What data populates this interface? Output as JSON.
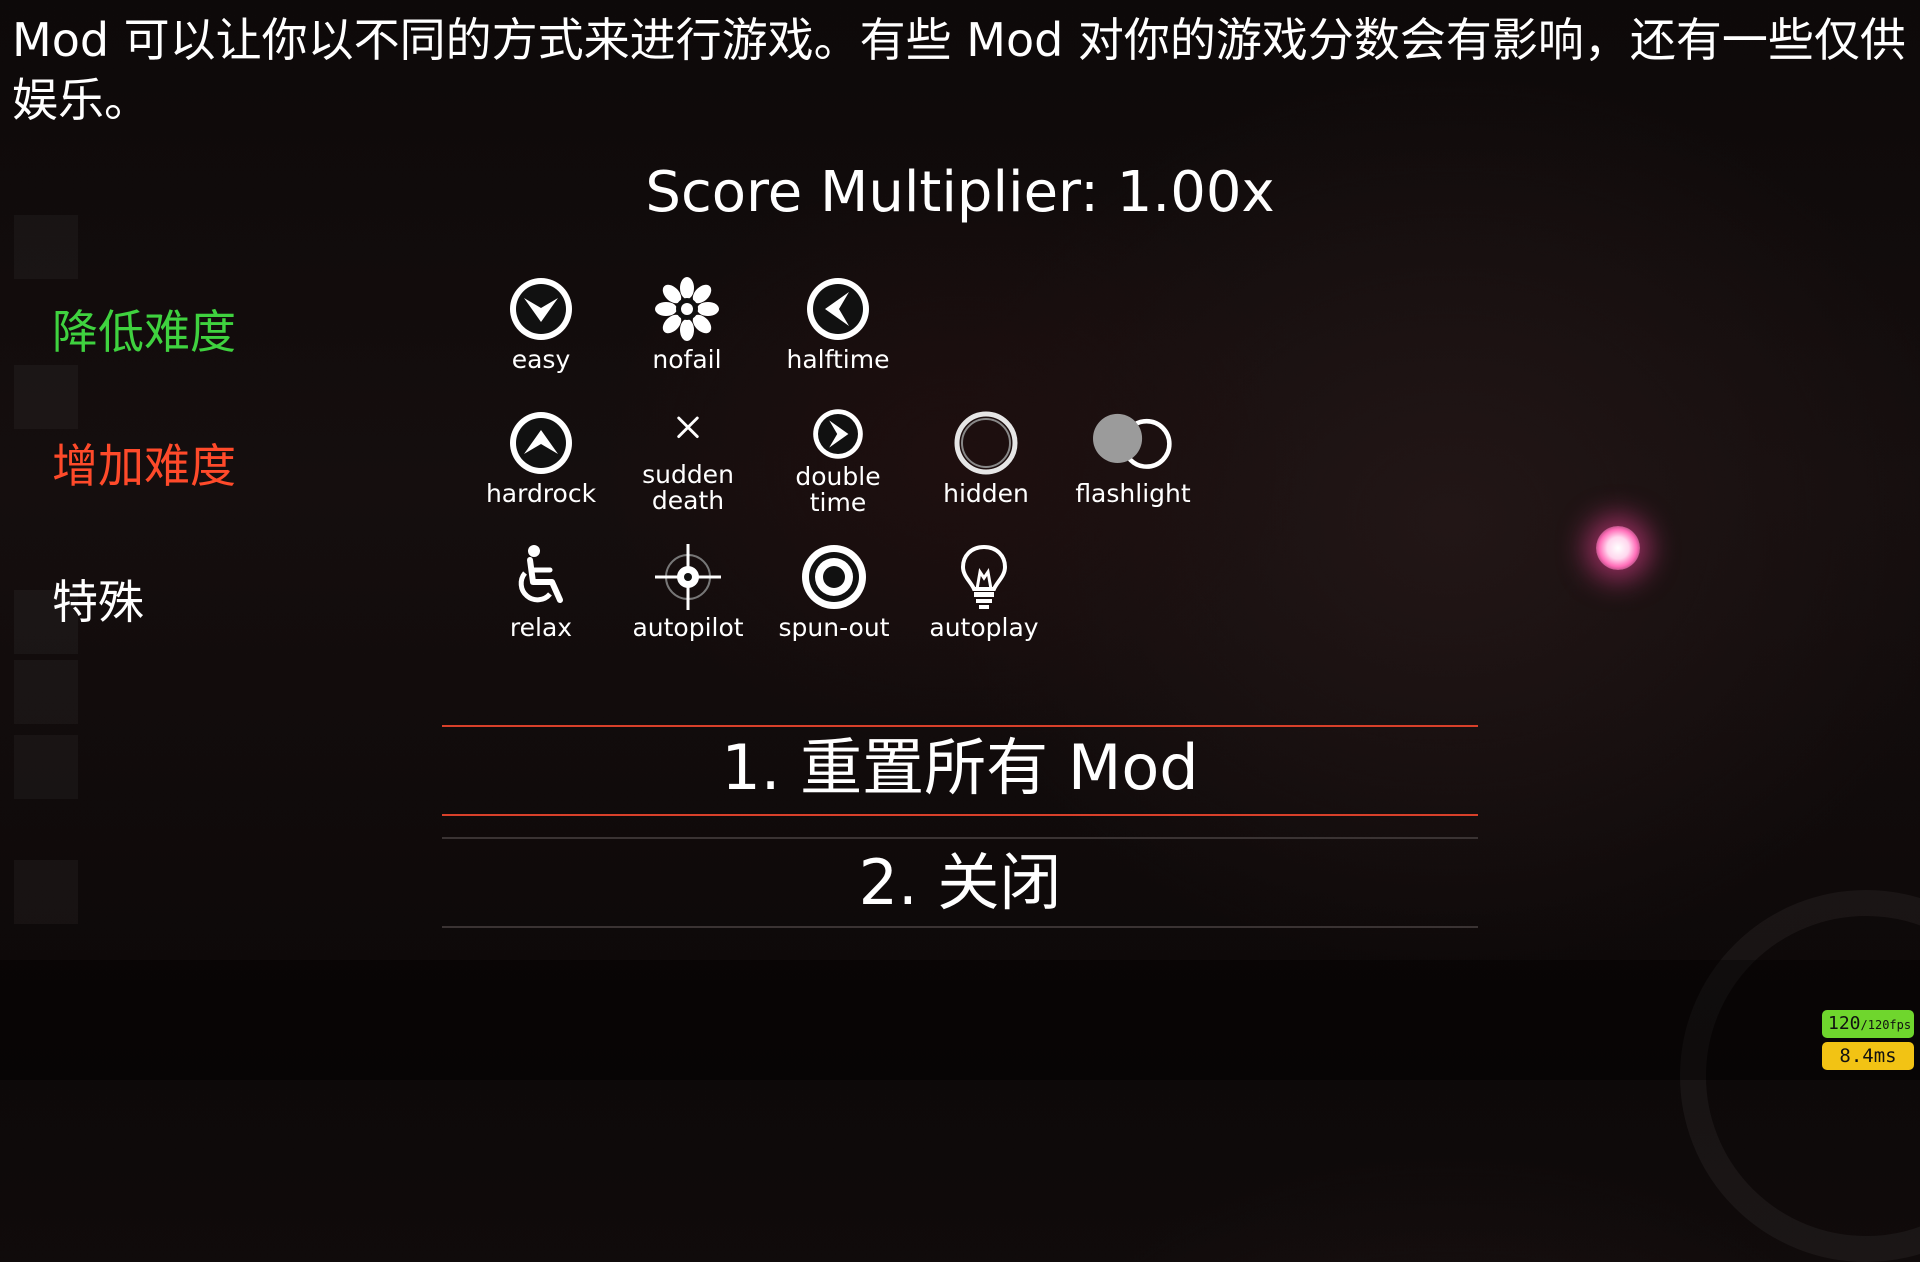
{
  "description": "Mod 可以让你以不同的方式来进行游戏。有些 Mod 对你的游戏分数会有影响，还有一些仅供娱乐。",
  "score_multiplier": "Score Multiplier: 1.00x",
  "categories": [
    {
      "label": "降低难度",
      "color": "#3fd23f"
    },
    {
      "label": "增加难度",
      "color": "#ff4a2a"
    },
    {
      "label": "特殊",
      "color": "#ffffff"
    }
  ],
  "mods": {
    "easy": {
      "label": "easy",
      "icon": "chevron-down-circle-icon"
    },
    "nofail": {
      "label": "nofail",
      "icon": "flower-icon"
    },
    "halftime": {
      "label": "halftime",
      "icon": "chevron-left-circle-icon"
    },
    "hardrock": {
      "label": "hardrock",
      "icon": "chevron-up-circle-icon"
    },
    "suddendeath": {
      "label": "sudden\ndeath",
      "icon": "x-icon"
    },
    "doubletime": {
      "label": "double\ntime",
      "icon": "chevron-right-circle-icon"
    },
    "hidden": {
      "label": "hidden",
      "icon": "ring-icon"
    },
    "flashlight": {
      "label": "flashlight",
      "icon": "flashlight-icon"
    },
    "relax": {
      "label": "relax",
      "icon": "wheelchair-icon"
    },
    "autopilot": {
      "label": "autopilot",
      "icon": "crosshair-icon"
    },
    "spunout": {
      "label": "spun-out",
      "icon": "target-icon"
    },
    "autoplay": {
      "label": "autoplay",
      "icon": "lightbulb-icon"
    }
  },
  "menu": {
    "reset": "1. 重置所有 Mod",
    "close": "2. 关闭"
  },
  "perf": {
    "fps": "120",
    "fps_max": "/120fps",
    "frametime": "8.4ms"
  },
  "colors": {
    "accent_line": "#d8402a",
    "fps_badge": "#6fd62d",
    "frametime_badge": "#f2c314",
    "cursor_glow": "#ff6db8"
  }
}
